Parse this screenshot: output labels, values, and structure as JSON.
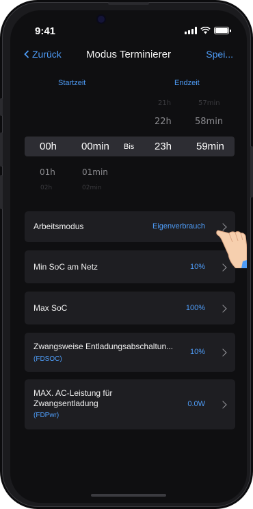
{
  "status": {
    "time": "9:41"
  },
  "nav": {
    "back_label": "Zurück",
    "title": "Modus Terminierer",
    "save_label": "Spei..."
  },
  "picker": {
    "start_label": "Startzeit",
    "end_label": "Endzeit",
    "separator": "Bis",
    "start_above": [],
    "start_hours_below": [
      "01h",
      "02h"
    ],
    "start_minutes_below": [
      "01min",
      "02min"
    ],
    "end_hours_above": [
      "21h",
      "22h"
    ],
    "end_minutes_above": [
      "57min",
      "58min"
    ],
    "selected": {
      "start_hour": "00h",
      "start_minute": "00min",
      "end_hour": "23h",
      "end_minute": "59min"
    }
  },
  "settings": [
    {
      "label": "Arbeitsmodus",
      "sub": "",
      "value": "Eigenverbrauch"
    },
    {
      "label": "Min SoC am Netz",
      "sub": "",
      "value": "10%"
    },
    {
      "label": "Max SoC",
      "sub": "",
      "value": "100%"
    },
    {
      "label": "Zwangsweise Entladungsabschaltun...",
      "sub": "(FDSOC)",
      "value": "10%"
    },
    {
      "label": "MAX. AC-Leistung für Zwangsentladung",
      "sub": "(FDPwr)",
      "value": "0.0W"
    }
  ],
  "colors": {
    "accent": "#4e9cf7",
    "background": "#0f0f11",
    "card": "#1e1e22"
  },
  "icons": {
    "back": "chevron-left-icon",
    "row_arrow": "chevron-right-icon",
    "pointer": "pointing-hand-icon"
  }
}
